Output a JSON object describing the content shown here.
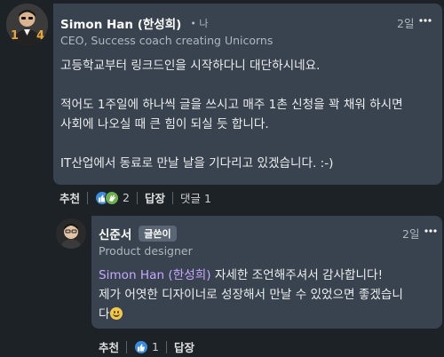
{
  "main_comment": {
    "author": "Simon Han (한성희)",
    "degree": "• 나",
    "headline": "CEO, Success coach creating Unicorns",
    "time": "2일",
    "paragraphs": [
      "고등학교부터 링크드인을 시작하다니 대단하시네요.",
      "적어도 1주일에 하나씩 글을 쓰시고 매주 1촌 신청을 꽉 채워 하시면",
      "사회에 나오실 때 큰 힘이 되실 듯 합니다.",
      "IT산업에서 동료로 만날 날을 기다리고 있겠습니다. :-)"
    ],
    "actions": {
      "like_label": "추천",
      "reaction_count": "2",
      "reply_label": "답장",
      "replies_count_label": "댓글 1"
    },
    "avatar_text": "1 4"
  },
  "reply_comment": {
    "author": "신준서",
    "badge": "글쓴이",
    "headline": "Product designer",
    "time": "2일",
    "mention": "Simon Han (한성희)",
    "line1_rest": " 자세한 조언해주셔서 감사합니다!",
    "line2": "제가 어엿한 디자이너로 성장해서 만날 수 있었으면 좋겠습니",
    "line3": "다",
    "actions": {
      "like_label": "추천",
      "reaction_count": "1",
      "reply_label": "답장"
    }
  },
  "colors": {
    "background": "#1d2226",
    "bubble": "#38434f",
    "mention": "#c8a8ff",
    "like_blue": "#3a8cdf",
    "clap_green": "#6dae4f"
  }
}
